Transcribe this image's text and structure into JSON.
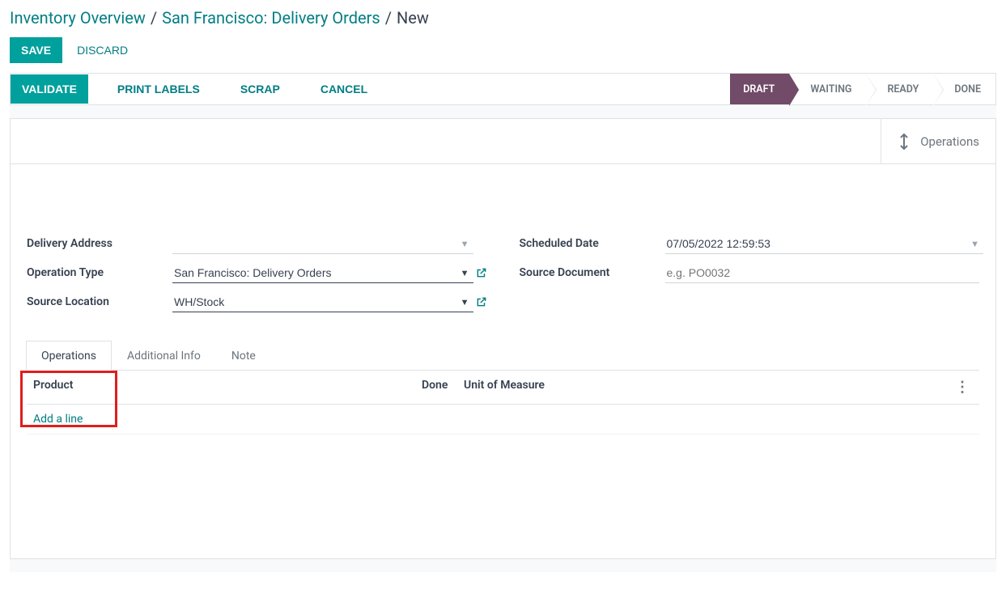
{
  "breadcrumb": {
    "root": "Inventory Overview",
    "middle": "San Francisco: Delivery Orders",
    "current": "New"
  },
  "buttons": {
    "save": "SAVE",
    "discard": "DISCARD",
    "validate": "VALIDATE",
    "print_labels": "PRINT LABELS",
    "scrap": "SCRAP",
    "cancel": "CANCEL"
  },
  "status": {
    "draft": "DRAFT",
    "waiting": "WAITING",
    "ready": "READY",
    "done": "DONE"
  },
  "sheet": {
    "operations_stat": "Operations",
    "labels": {
      "delivery_address": "Delivery Address",
      "operation_type": "Operation Type",
      "source_location": "Source Location",
      "scheduled_date": "Scheduled Date",
      "source_document": "Source Document"
    },
    "values": {
      "delivery_address": "",
      "operation_type": "San Francisco: Delivery Orders",
      "source_location": "WH/Stock",
      "scheduled_date": "07/05/2022 12:59:53",
      "source_document": ""
    },
    "placeholders": {
      "source_document": "e.g. PO0032"
    }
  },
  "tabs": {
    "operations": "Operations",
    "additional": "Additional Info",
    "note": "Note"
  },
  "grid": {
    "cols": {
      "product": "Product",
      "done": "Done",
      "uom": "Unit of Measure"
    },
    "add_line": "Add a line"
  }
}
